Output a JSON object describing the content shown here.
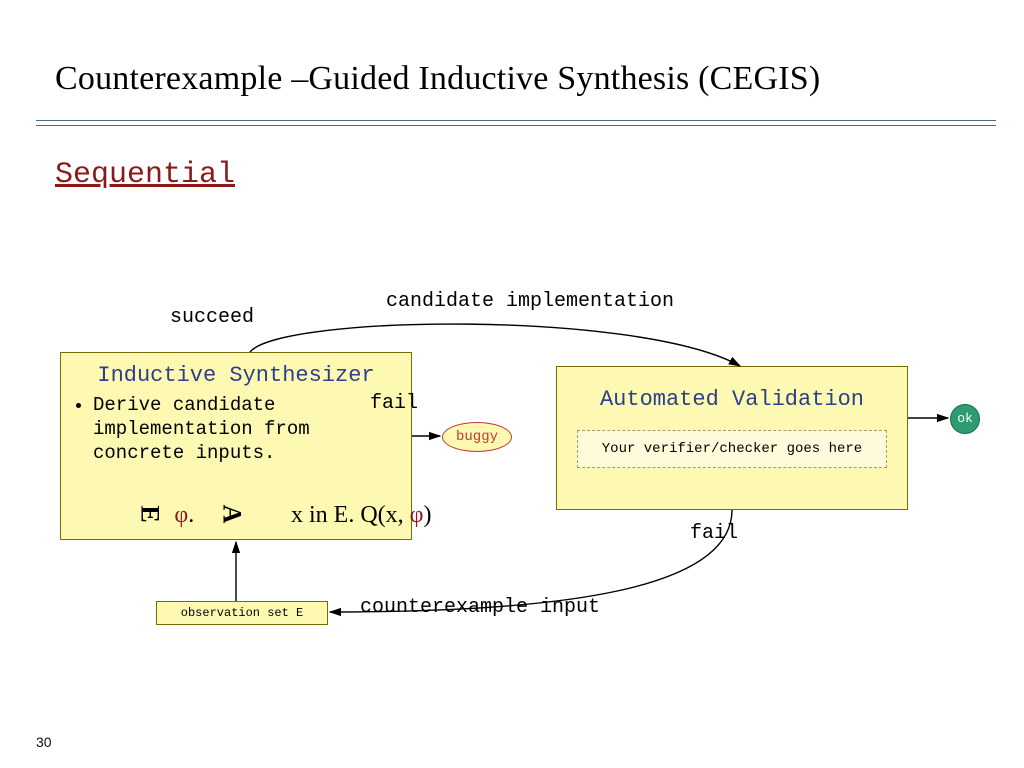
{
  "title": "Counterexample –Guided Inductive Synthesis (CEGIS)",
  "subhead": "Sequential",
  "labels": {
    "succeed": "succeed",
    "candidate": "candidate implementation",
    "fail_left": "fail",
    "fail_right": "fail",
    "counterexample": "counterexample input"
  },
  "synth": {
    "title": "Inductive Synthesizer",
    "bullet": "Derive candidate implementation from concrete inputs.",
    "formula_text": "∃ φ. ∀ x in E. Q(x, φ)"
  },
  "validation": {
    "title": "Automated Validation",
    "slot": "Your verifier/checker  goes here"
  },
  "buggy": "buggy",
  "ok": "ok",
  "observation_box": "observation set E",
  "page_number": "30"
}
